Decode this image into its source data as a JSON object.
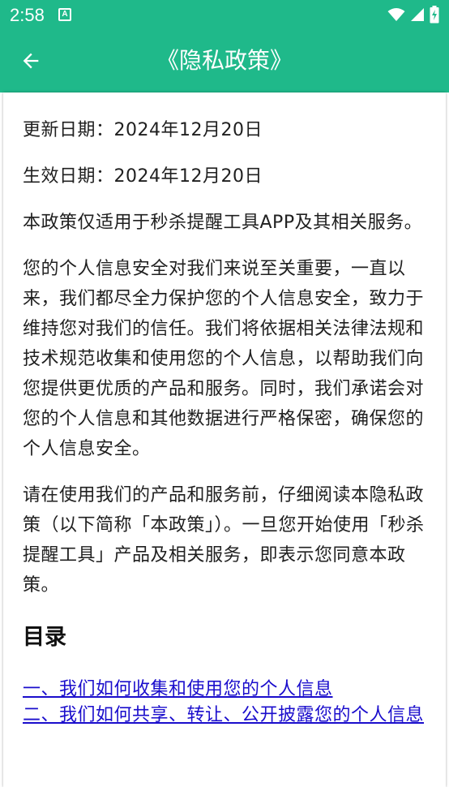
{
  "status_bar": {
    "time": "2:58",
    "notification_letter": "A",
    "icons": [
      "wifi-icon",
      "signal-icon",
      "battery-charging-icon"
    ]
  },
  "app_bar": {
    "back_icon": "arrow-left-icon",
    "title": "《隐私政策》"
  },
  "content": {
    "update_date": "更新日期：2024年12月20日",
    "effective_date": "生效日期：2024年12月20日",
    "scope": "本政策仅适用于秒杀提醒工具APP及其相关服务。",
    "intro": "您的个人信息安全对我们来说至关重要，一直以来，我们都尽全力保护您的个人信息安全，致力于维持您对我们的信任。我们将依据相关法律法规和技术规范收集和使用您的个人信息，以帮助我们向您提供更优质的产品和服务。同时，我们承诺会对您的个人信息和其他数据进行严格保密，确保您的个人信息安全。",
    "notice": "请在使用我们的产品和服务前，仔细阅读本隐私政策（以下简称「本政策」）。一旦您开始使用「秒杀提醒工具」产品及相关服务，即表示您同意本政策。",
    "toc_heading": "目录",
    "toc": [
      {
        "label": "一、我们如何收集和使用您的个人信息"
      },
      {
        "label": "二、我们如何共享、转让、公开披露您的个人信息"
      }
    ]
  },
  "colors": {
    "primary": "#1fb98a",
    "link": "#1a0dcc",
    "text": "#202020"
  }
}
